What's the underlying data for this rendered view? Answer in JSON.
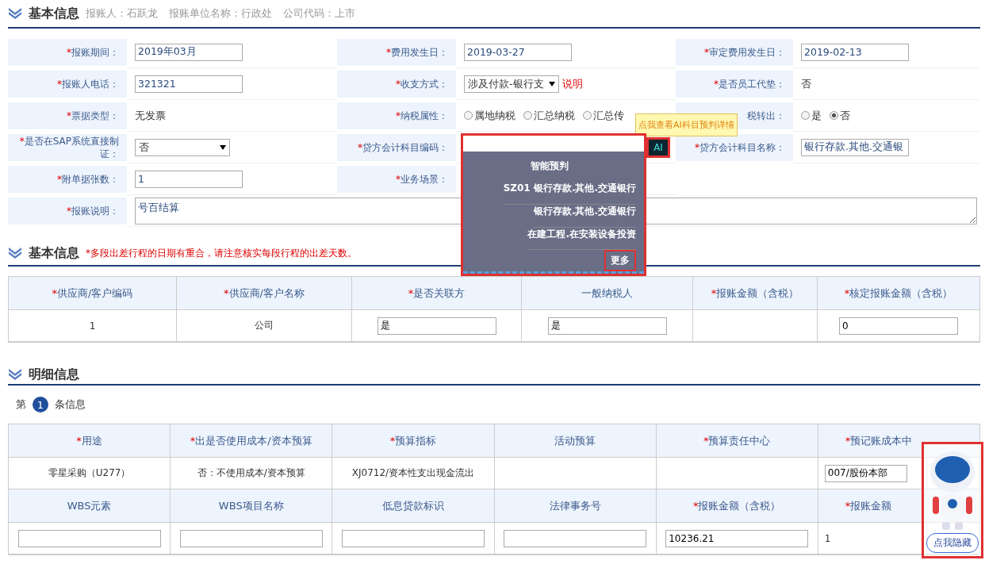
{
  "header": {
    "title": "基本信息",
    "info": [
      "报账人：石跃龙",
      "报账单位名称：行政处",
      "公司代码：上市"
    ]
  },
  "form": [
    {
      "kind": "input",
      "mark": "*",
      "label": "报账期间：",
      "value": "2019年03月"
    },
    {
      "kind": "input",
      "mark": "*",
      "label": "费用发生日：",
      "value": "2019-03-27"
    },
    {
      "kind": "input",
      "mark": "*",
      "label": "审定费用发生日：",
      "value": "2019-02-13"
    },
    {
      "kind": "input",
      "mark": "*",
      "label": "报账人电话：",
      "value": "321321"
    },
    {
      "kind": "select",
      "mark": "*",
      "label": "收支方式：",
      "value": "涉及付款-银行支",
      "link": "说明"
    },
    {
      "kind": "text",
      "mark": "*",
      "label": "是否员工代垫：",
      "value": "否"
    },
    {
      "kind": "text",
      "mark": "*",
      "label": "票据类型：",
      "value": "无发票"
    },
    {
      "kind": "radios",
      "mark": "*",
      "label": "纳税属性：",
      "options": [
        {
          "label": "属地纳税",
          "selected": false
        },
        {
          "label": "汇总纳税",
          "selected": false
        },
        {
          "label": "汇总传",
          "selected": false
        }
      ]
    },
    {
      "kind": "radios",
      "label": "税转出：",
      "options": [
        {
          "label": "是",
          "selected": false
        },
        {
          "label": "否",
          "selected": true
        }
      ]
    },
    {
      "kind": "select",
      "mark": "*",
      "label": "是否在SAP系统直接制证：",
      "value": "否"
    },
    {
      "kind": "ai",
      "mark": "*",
      "label": "贷方会计科目编码：",
      "ai_label": "AI",
      "tooltip": "点我查看AI科目预判详情"
    },
    {
      "kind": "input",
      "mark": "*",
      "label": "贷方会计科目名称：",
      "value": "银行存款.其他.交通银"
    },
    {
      "kind": "input",
      "mark": "*",
      "label": "附单据张数：",
      "value": "1"
    },
    {
      "kind": "blank",
      "mark": "*",
      "label": "业务场景："
    },
    {
      "kind": "textarea",
      "mark": "*",
      "label": "报账说明：",
      "value": "号百结算"
    }
  ],
  "popup": {
    "title": "智能预判",
    "items": [
      {
        "code": "SZ01",
        "name": "银行存款.其他.交通银行"
      },
      {
        "name": "银行存款.其他.交通银行"
      },
      {
        "name": "在建工程.在安装设备投资"
      }
    ],
    "more": "更多"
  },
  "section2": {
    "title": "基本信息",
    "note": "*多段出差行程的日期有重合，请注意核实每段行程的出差天数。",
    "columns": [
      {
        "mark": "*",
        "label": "供应商/客户编码"
      },
      {
        "mark": "*",
        "label": "供应商/客户名称"
      },
      {
        "mark": "*",
        "label": "是否关联方"
      },
      {
        "label": "一般纳税人"
      },
      {
        "mark": "*",
        "label": "报账金额（含税）"
      },
      {
        "mark": "*",
        "label": "核定报账金额（含税）"
      }
    ],
    "rows": [
      [
        {
          "kind": "text",
          "value": "1"
        },
        {
          "kind": "text",
          "value": "公司"
        },
        {
          "kind": "input",
          "value": "是"
        },
        {
          "kind": "input",
          "value": "是"
        },
        {
          "kind": "blank"
        },
        {
          "kind": "input",
          "value": "0"
        }
      ]
    ]
  },
  "section3": {
    "title": "明细信息",
    "record": {
      "prefix": "第",
      "index": "1",
      "suffix": "条信息"
    },
    "groups": [
      {
        "columns": [
          {
            "mark": "*",
            "label": "用途"
          },
          {
            "mark": "*",
            "label": "出是否使用成本/资本预算"
          },
          {
            "mark": "*",
            "label": "预算指标"
          },
          {
            "label": "活动预算"
          },
          {
            "mark": "*",
            "label": "预算责任中心"
          },
          {
            "mark": "*",
            "label": "预记账成本中"
          }
        ],
        "row": [
          {
            "kind": "text",
            "value": "零星采购（U277）"
          },
          {
            "kind": "text",
            "value": "否：不使用成本/资本预算"
          },
          {
            "kind": "text",
            "value": "XJ0712/资本性支出现金流出"
          },
          {
            "kind": "blank"
          },
          {
            "kind": "blank"
          },
          {
            "kind": "input",
            "value": "007/股份本部"
          }
        ]
      },
      {
        "columns": [
          {
            "label": "WBS元素"
          },
          {
            "label": "WBS项目名称"
          },
          {
            "label": "低息贷款标识"
          },
          {
            "label": "法律事务号"
          },
          {
            "mark": "*",
            "label": "报账金额（含税）"
          },
          {
            "mark": "*",
            "label": "报账金额"
          }
        ],
        "row": [
          {
            "kind": "input"
          },
          {
            "kind": "input"
          },
          {
            "kind": "input"
          },
          {
            "kind": "input"
          },
          {
            "kind": "input",
            "value": "10236.21"
          },
          {
            "kind": "text",
            "value": "1"
          }
        ]
      }
    ]
  },
  "robot": {
    "button": "点我隐藏"
  }
}
